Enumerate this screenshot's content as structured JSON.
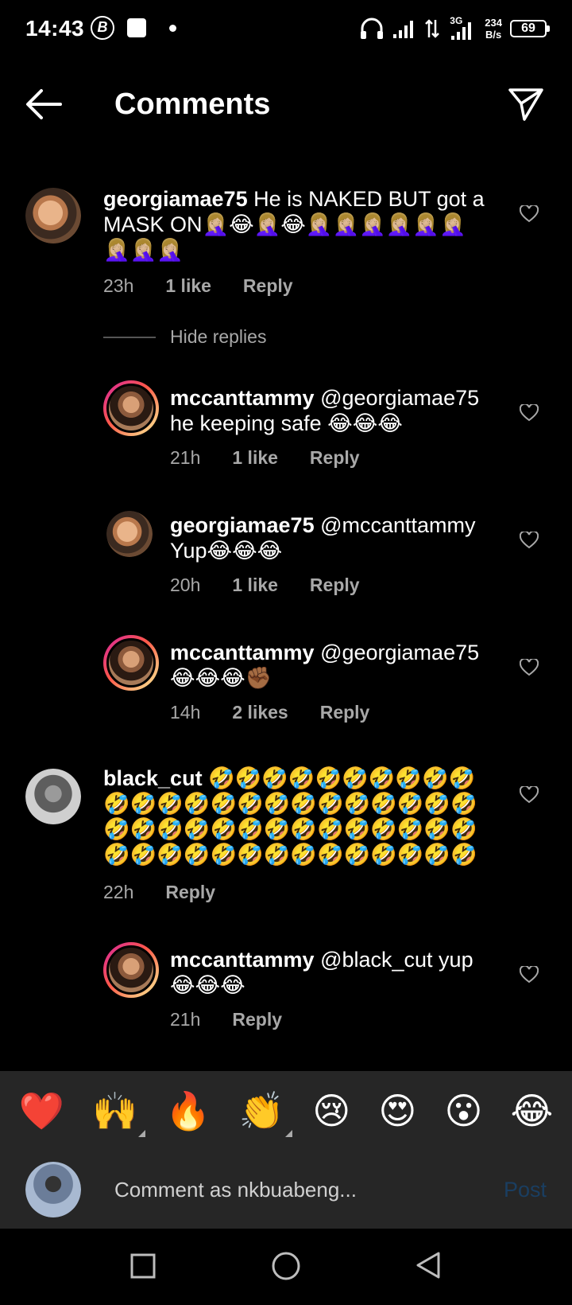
{
  "status_bar": {
    "time": "14:43",
    "b_badge": "B",
    "network": "3G",
    "speed_top": "234",
    "speed_bottom": "B/s",
    "battery": "69"
  },
  "header": {
    "title": "Comments"
  },
  "comments": [
    {
      "username": "georgiamae75",
      "text": " He is NAKED BUT got a MASK ON🤦🏼‍♀️😂🤦🏼‍♀️😂🤦🏼‍♀️🤦🏼‍♀️🤦🏼‍♀️🤦🏼‍♀️🤦🏼‍♀️🤦🏼‍♀️🤦🏼‍♀️🤦🏼‍♀️🤦🏼‍♀️",
      "time": "23h",
      "likes": "1 like",
      "reply": "Reply"
    },
    {
      "username": "mccanttammy",
      "text": " @georgiamae75 he keeping safe 😂😂😂",
      "time": "21h",
      "likes": "1 like",
      "reply": "Reply"
    },
    {
      "username": "georgiamae75",
      "text": " @mccanttammy Yup😂😂😂",
      "time": "20h",
      "likes": "1 like",
      "reply": "Reply"
    },
    {
      "username": "mccanttammy",
      "text": " @georgiamae75 😂😂😂✊🏾",
      "time": "14h",
      "likes": "2 likes",
      "reply": "Reply"
    },
    {
      "username": "black_cut",
      "text": " 🤣🤣🤣🤣🤣🤣🤣🤣🤣🤣🤣🤣🤣🤣🤣🤣🤣🤣🤣🤣🤣🤣🤣🤣🤣🤣🤣🤣🤣🤣🤣🤣🤣🤣🤣🤣🤣🤣🤣🤣🤣🤣🤣🤣🤣🤣🤣🤣🤣🤣🤣🤣",
      "time": "22h",
      "reply": "Reply"
    },
    {
      "username": "mccanttammy",
      "text": " @black_cut yup 😂😂😂",
      "time": "21h",
      "reply": "Reply"
    }
  ],
  "hide_replies": "Hide replies",
  "emoji_bar": [
    "❤️",
    "🙌",
    "🔥",
    "👏",
    "😢",
    "😍",
    "😮",
    "😂"
  ],
  "composer": {
    "placeholder": "Comment as nkbuabeng...",
    "post": "Post"
  },
  "colors": {
    "background": "#000000",
    "secondary_text": "#a8a8a8",
    "bar_background": "#262626",
    "post_disabled": "#1a3e61"
  }
}
